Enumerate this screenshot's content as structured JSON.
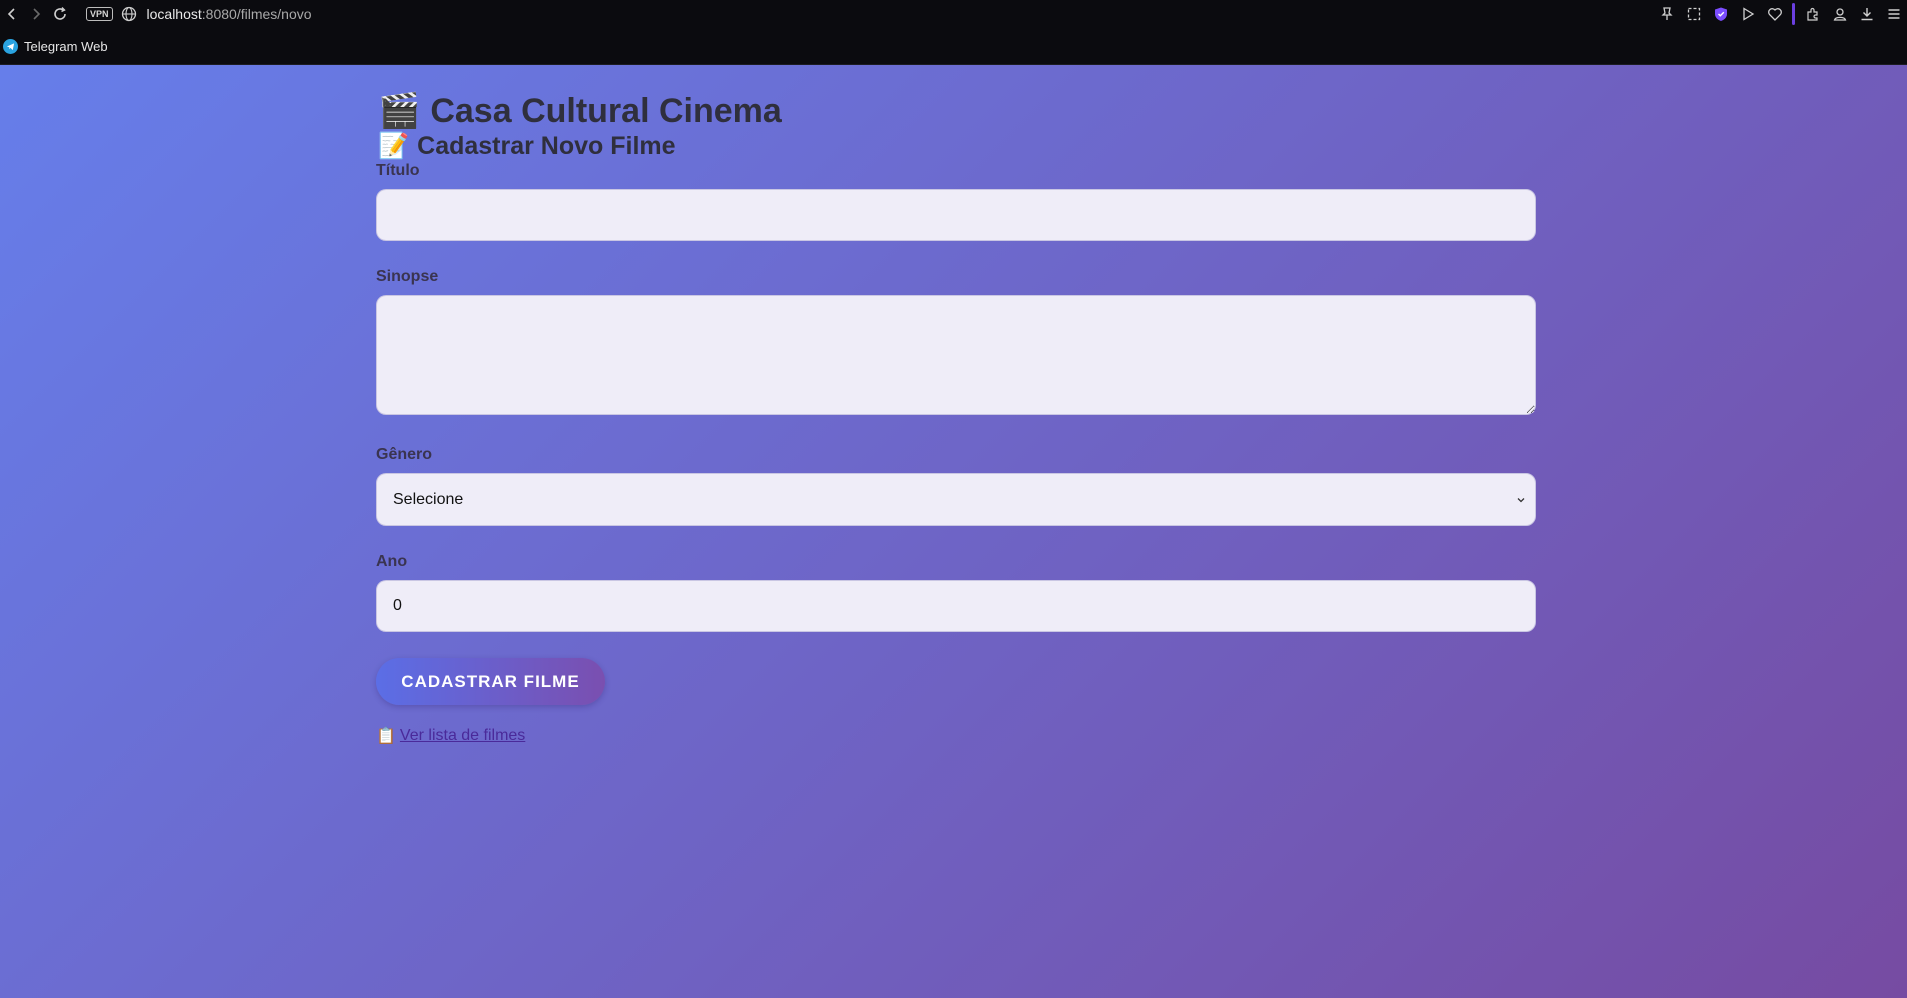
{
  "browser": {
    "url_host": "localhost",
    "url_path": ":8080/filmes/novo",
    "vpn_label": "VPN",
    "bookmark_label": "Telegram Web"
  },
  "header": {
    "title_emoji": "🎬",
    "title": "Casa Cultural Cinema",
    "subtitle_emoji": "📝",
    "subtitle": "Cadastrar Novo Filme"
  },
  "form": {
    "titulo_label": "Título",
    "titulo_value": "",
    "sinopse_label": "Sinopse",
    "sinopse_value": "",
    "genero_label": "Gênero",
    "genero_selected": "Selecione",
    "ano_label": "Ano",
    "ano_value": "0",
    "submit_label": "CADASTRAR FILME"
  },
  "links": {
    "list_emoji": "📋",
    "list_label": "Ver lista de filmes"
  },
  "colors": {
    "gradient_start": "#667eea",
    "gradient_end": "#764ba2",
    "link": "#4a2a9a"
  }
}
